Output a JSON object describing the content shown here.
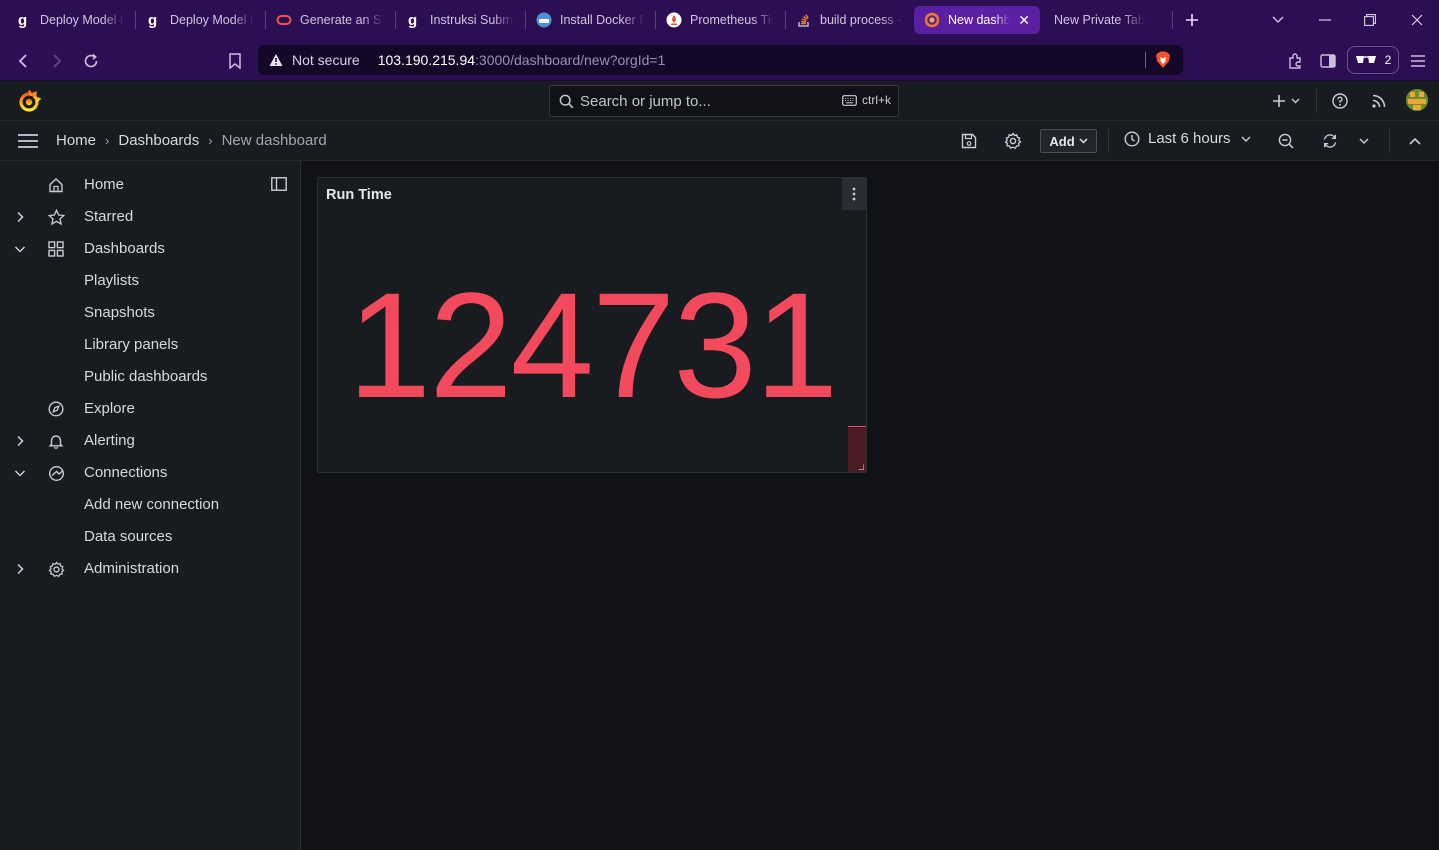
{
  "browser": {
    "tabs": [
      {
        "title": "Deploy Model M",
        "icon": "gitbook-icon"
      },
      {
        "title": "Deploy Model M",
        "icon": "gitbook-icon"
      },
      {
        "title": "Generate an SSH",
        "icon": "oracle-icon"
      },
      {
        "title": "Instruksi Submis",
        "icon": "gitbook-icon"
      },
      {
        "title": "Install Docker E",
        "icon": "docker-icon"
      },
      {
        "title": "Prometheus Tim",
        "icon": "prometheus-icon"
      },
      {
        "title": "build process - I",
        "icon": "stackoverflow-icon"
      },
      {
        "title": "New dashb",
        "icon": "grafana-icon",
        "active": true
      },
      {
        "title": "New Private Tab",
        "icon": ""
      }
    ],
    "security_label": "Not secure",
    "url_host": "103.190.215.94",
    "url_rest": ":3000/dashboard/new?orgId=1",
    "shields_count": "2",
    "accent": "#2c0f52",
    "active_tab": "#5b1fa3"
  },
  "grafana": {
    "search_placeholder": "Search or jump to...",
    "search_shortcut": "ctrl+k",
    "breadcrumbs": [
      "Home",
      "Dashboards",
      "New dashboard"
    ],
    "add_label": "Add",
    "time_range": "Last 6 hours",
    "sidebar": {
      "items": [
        {
          "label": "Home",
          "icon": "home-icon"
        },
        {
          "label": "Starred",
          "icon": "star-icon",
          "chevron": "collapsed"
        },
        {
          "label": "Dashboards",
          "icon": "apps-icon",
          "chevron": "expanded"
        },
        {
          "label": "Playlists"
        },
        {
          "label": "Snapshots"
        },
        {
          "label": "Library panels"
        },
        {
          "label": "Public dashboards"
        },
        {
          "label": "Explore",
          "icon": "compass-icon"
        },
        {
          "label": "Alerting",
          "icon": "bell-icon",
          "chevron": "collapsed"
        },
        {
          "label": "Connections",
          "icon": "connections-icon",
          "chevron": "expanded"
        },
        {
          "label": "Add new connection"
        },
        {
          "label": "Data sources"
        },
        {
          "label": "Administration",
          "icon": "cog-icon",
          "chevron": "collapsed"
        }
      ]
    },
    "panel": {
      "title": "Run Time",
      "value": "124731",
      "value_color": "#f2495c"
    }
  }
}
